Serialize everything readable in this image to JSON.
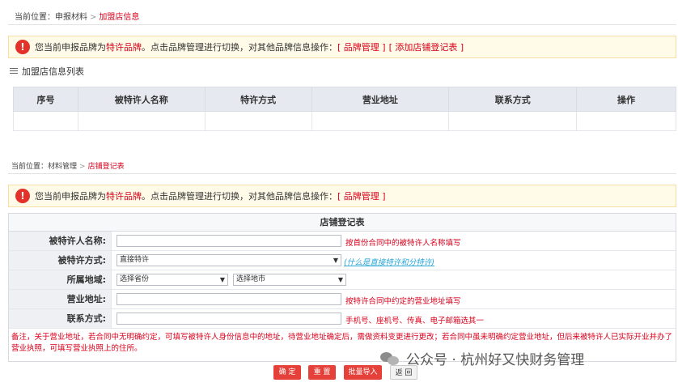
{
  "panel1": {
    "breadcrumb": {
      "prefix": "当前位置：",
      "parent": "申报材料",
      "separator": ">",
      "current": "加盟店信息"
    },
    "notice": {
      "icon": "warning-icon",
      "text_before": "您当前申报品牌为",
      "brand": "特许品牌",
      "text_after": "。点击品牌管理进行切换，对其他品牌信息操作：",
      "link1": "[ 品牌管理 ]",
      "link2": "[ 添加店铺登记表 ]"
    },
    "list_title": "加盟店信息列表",
    "table": {
      "headers": [
        "序号",
        "被特许人名称",
        "特许方式",
        "营业地址",
        "联系方式",
        "操作"
      ]
    }
  },
  "panel2": {
    "breadcrumb": {
      "prefix": "当前位置：",
      "parent": "材料管理",
      "separator": ">",
      "current": "店铺登记表"
    },
    "notice": {
      "icon": "warning-icon",
      "text_before": "您当前申报品牌为",
      "brand": "特许品牌",
      "text_after": "。点击品牌管理进行切换，对其他品牌信息操作：",
      "link1": "[ 品牌管理 ]"
    },
    "form": {
      "title": "店铺登记表",
      "rows": [
        {
          "label": "被特许人名称:",
          "hint": "按首份合同中的被特许人名称填写"
        },
        {
          "label": "被特许方式:",
          "select_value": "直接特许",
          "hint": "(什么是直接特许和分特许)"
        },
        {
          "label": "所属地域:",
          "province": "选择省份",
          "city": "选择地市"
        },
        {
          "label": "营业地址:",
          "hint": "按特许合同中约定的营业地址填写"
        },
        {
          "label": "联系方式:",
          "hint": "手机号、座机号、传真、电子邮箱选其一"
        }
      ],
      "note": "备注，关于营业地址，若合同中无明确约定，可填写被特许人身份信息中的地址，待营业地址确定后，需做资料变更进行更改；若合同中虽未明确约定营业地址，但后来被特许人已实际开业并办了营业执照，可填写营业执照上的住所。",
      "buttons": {
        "confirm": "确 定",
        "reset": "重 置",
        "batch_import": "批量导入",
        "back": "返 回"
      }
    }
  },
  "watermark": {
    "text": "公众号 · 杭州好又快财务管理",
    "icon": "wechat-icon"
  },
  "colors": {
    "accent": "#d9001b",
    "button": "#e5403a",
    "notice_bg": "#fffbe8",
    "header_bg": "#e6eaf0"
  }
}
